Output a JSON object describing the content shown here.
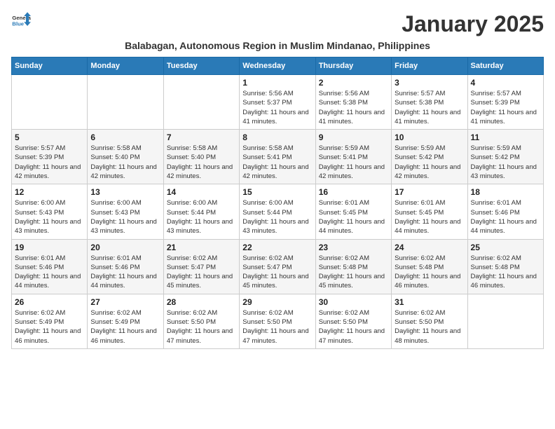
{
  "logo": {
    "line1": "General",
    "line2": "Blue"
  },
  "title": "January 2025",
  "subtitle": "Balabagan, Autonomous Region in Muslim Mindanao, Philippines",
  "weekdays": [
    "Sunday",
    "Monday",
    "Tuesday",
    "Wednesday",
    "Thursday",
    "Friday",
    "Saturday"
  ],
  "weeks": [
    [
      {
        "day": "",
        "sunrise": "",
        "sunset": "",
        "daylight": ""
      },
      {
        "day": "",
        "sunrise": "",
        "sunset": "",
        "daylight": ""
      },
      {
        "day": "",
        "sunrise": "",
        "sunset": "",
        "daylight": ""
      },
      {
        "day": "1",
        "sunrise": "Sunrise: 5:56 AM",
        "sunset": "Sunset: 5:37 PM",
        "daylight": "Daylight: 11 hours and 41 minutes."
      },
      {
        "day": "2",
        "sunrise": "Sunrise: 5:56 AM",
        "sunset": "Sunset: 5:38 PM",
        "daylight": "Daylight: 11 hours and 41 minutes."
      },
      {
        "day": "3",
        "sunrise": "Sunrise: 5:57 AM",
        "sunset": "Sunset: 5:38 PM",
        "daylight": "Daylight: 11 hours and 41 minutes."
      },
      {
        "day": "4",
        "sunrise": "Sunrise: 5:57 AM",
        "sunset": "Sunset: 5:39 PM",
        "daylight": "Daylight: 11 hours and 41 minutes."
      }
    ],
    [
      {
        "day": "5",
        "sunrise": "Sunrise: 5:57 AM",
        "sunset": "Sunset: 5:39 PM",
        "daylight": "Daylight: 11 hours and 42 minutes."
      },
      {
        "day": "6",
        "sunrise": "Sunrise: 5:58 AM",
        "sunset": "Sunset: 5:40 PM",
        "daylight": "Daylight: 11 hours and 42 minutes."
      },
      {
        "day": "7",
        "sunrise": "Sunrise: 5:58 AM",
        "sunset": "Sunset: 5:40 PM",
        "daylight": "Daylight: 11 hours and 42 minutes."
      },
      {
        "day": "8",
        "sunrise": "Sunrise: 5:58 AM",
        "sunset": "Sunset: 5:41 PM",
        "daylight": "Daylight: 11 hours and 42 minutes."
      },
      {
        "day": "9",
        "sunrise": "Sunrise: 5:59 AM",
        "sunset": "Sunset: 5:41 PM",
        "daylight": "Daylight: 11 hours and 42 minutes."
      },
      {
        "day": "10",
        "sunrise": "Sunrise: 5:59 AM",
        "sunset": "Sunset: 5:42 PM",
        "daylight": "Daylight: 11 hours and 42 minutes."
      },
      {
        "day": "11",
        "sunrise": "Sunrise: 5:59 AM",
        "sunset": "Sunset: 5:42 PM",
        "daylight": "Daylight: 11 hours and 43 minutes."
      }
    ],
    [
      {
        "day": "12",
        "sunrise": "Sunrise: 6:00 AM",
        "sunset": "Sunset: 5:43 PM",
        "daylight": "Daylight: 11 hours and 43 minutes."
      },
      {
        "day": "13",
        "sunrise": "Sunrise: 6:00 AM",
        "sunset": "Sunset: 5:43 PM",
        "daylight": "Daylight: 11 hours and 43 minutes."
      },
      {
        "day": "14",
        "sunrise": "Sunrise: 6:00 AM",
        "sunset": "Sunset: 5:44 PM",
        "daylight": "Daylight: 11 hours and 43 minutes."
      },
      {
        "day": "15",
        "sunrise": "Sunrise: 6:00 AM",
        "sunset": "Sunset: 5:44 PM",
        "daylight": "Daylight: 11 hours and 43 minutes."
      },
      {
        "day": "16",
        "sunrise": "Sunrise: 6:01 AM",
        "sunset": "Sunset: 5:45 PM",
        "daylight": "Daylight: 11 hours and 44 minutes."
      },
      {
        "day": "17",
        "sunrise": "Sunrise: 6:01 AM",
        "sunset": "Sunset: 5:45 PM",
        "daylight": "Daylight: 11 hours and 44 minutes."
      },
      {
        "day": "18",
        "sunrise": "Sunrise: 6:01 AM",
        "sunset": "Sunset: 5:46 PM",
        "daylight": "Daylight: 11 hours and 44 minutes."
      }
    ],
    [
      {
        "day": "19",
        "sunrise": "Sunrise: 6:01 AM",
        "sunset": "Sunset: 5:46 PM",
        "daylight": "Daylight: 11 hours and 44 minutes."
      },
      {
        "day": "20",
        "sunrise": "Sunrise: 6:01 AM",
        "sunset": "Sunset: 5:46 PM",
        "daylight": "Daylight: 11 hours and 44 minutes."
      },
      {
        "day": "21",
        "sunrise": "Sunrise: 6:02 AM",
        "sunset": "Sunset: 5:47 PM",
        "daylight": "Daylight: 11 hours and 45 minutes."
      },
      {
        "day": "22",
        "sunrise": "Sunrise: 6:02 AM",
        "sunset": "Sunset: 5:47 PM",
        "daylight": "Daylight: 11 hours and 45 minutes."
      },
      {
        "day": "23",
        "sunrise": "Sunrise: 6:02 AM",
        "sunset": "Sunset: 5:48 PM",
        "daylight": "Daylight: 11 hours and 45 minutes."
      },
      {
        "day": "24",
        "sunrise": "Sunrise: 6:02 AM",
        "sunset": "Sunset: 5:48 PM",
        "daylight": "Daylight: 11 hours and 46 minutes."
      },
      {
        "day": "25",
        "sunrise": "Sunrise: 6:02 AM",
        "sunset": "Sunset: 5:48 PM",
        "daylight": "Daylight: 11 hours and 46 minutes."
      }
    ],
    [
      {
        "day": "26",
        "sunrise": "Sunrise: 6:02 AM",
        "sunset": "Sunset: 5:49 PM",
        "daylight": "Daylight: 11 hours and 46 minutes."
      },
      {
        "day": "27",
        "sunrise": "Sunrise: 6:02 AM",
        "sunset": "Sunset: 5:49 PM",
        "daylight": "Daylight: 11 hours and 46 minutes."
      },
      {
        "day": "28",
        "sunrise": "Sunrise: 6:02 AM",
        "sunset": "Sunset: 5:50 PM",
        "daylight": "Daylight: 11 hours and 47 minutes."
      },
      {
        "day": "29",
        "sunrise": "Sunrise: 6:02 AM",
        "sunset": "Sunset: 5:50 PM",
        "daylight": "Daylight: 11 hours and 47 minutes."
      },
      {
        "day": "30",
        "sunrise": "Sunrise: 6:02 AM",
        "sunset": "Sunset: 5:50 PM",
        "daylight": "Daylight: 11 hours and 47 minutes."
      },
      {
        "day": "31",
        "sunrise": "Sunrise: 6:02 AM",
        "sunset": "Sunset: 5:50 PM",
        "daylight": "Daylight: 11 hours and 48 minutes."
      },
      {
        "day": "",
        "sunrise": "",
        "sunset": "",
        "daylight": ""
      }
    ]
  ]
}
